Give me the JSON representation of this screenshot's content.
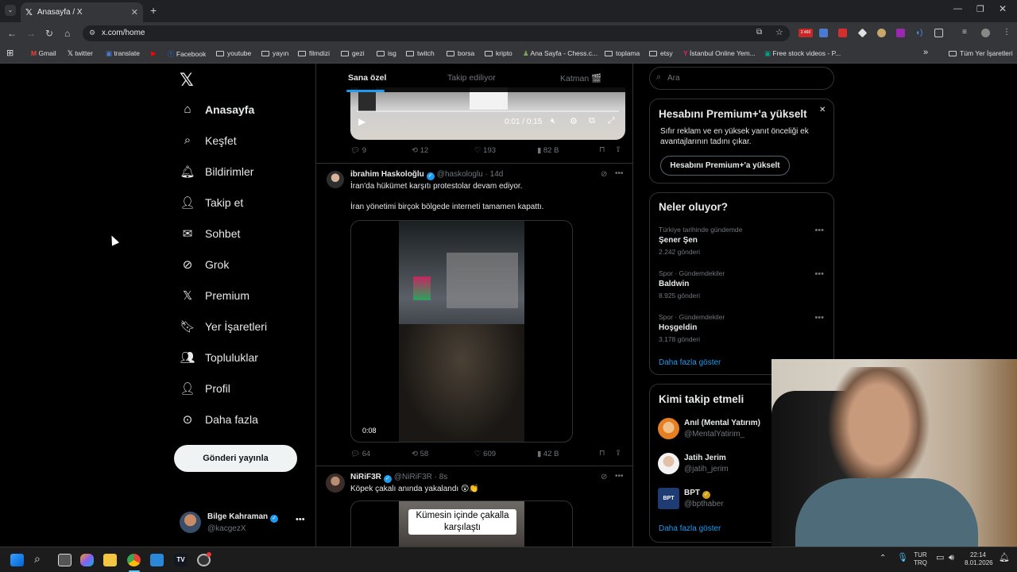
{
  "browser": {
    "tab_title": "Anasayfa / X",
    "url": "x.com/home",
    "bookmarks": [
      "Gmail",
      "twitter",
      "translate",
      "Facebook",
      "youtube",
      "yayın",
      "filmdizi",
      "gezi",
      "isg",
      "twitch",
      "borsa",
      "kripto",
      "Ana Sayfa - Chess.c...",
      "toplama",
      "etsy",
      "İstanbul Online Yem...",
      "Free stock videos - P...",
      "Tüm Yer İşaretleri"
    ],
    "ext_badge": "2.460"
  },
  "nav": {
    "items": [
      "Anasayfa",
      "Keşfet",
      "Bildirimler",
      "Takip et",
      "Sohbet",
      "Grok",
      "Premium",
      "Yer İşaretleri",
      "Topluluklar",
      "Profil",
      "Daha fazla"
    ],
    "post_button": "Gönderi yayınla",
    "profile_name": "Bilge Kahraman",
    "profile_handle": "@kacgezX"
  },
  "feed": {
    "tabs": [
      "Sana özel",
      "Takip ediliyor",
      "Katman 🎬"
    ],
    "top_video": {
      "time": "0:01 / 0:15",
      "replies": "9",
      "reposts": "12",
      "likes": "193",
      "views": "82 B"
    },
    "tweet1": {
      "name": "ibrahim Haskoloğlu",
      "handle": "@haskologlu",
      "time": "· 14d",
      "line1": "İran'da hükümet karşıtı protestolar devam ediyor.",
      "line2": "İran yönetimi birçok bölgede interneti tamamen kapattı.",
      "video_time": "0:08",
      "replies": "64",
      "reposts": "58",
      "likes": "609",
      "views": "42 B"
    },
    "tweet2": {
      "name": "NiRiF3R",
      "handle": "@NiRiF3R",
      "time": "· 8s",
      "text": "Köpek çakalı anında yakalandı 😲👏",
      "caption": "Kümesin içinde çakalla karşılaştı"
    }
  },
  "sidebar": {
    "search_placeholder": "Ara",
    "premium": {
      "title": "Hesabını Premium+'a yükselt",
      "body": "Sıfır reklam ve en yüksek yanıt önceliği ek avantajlarının tadını çıkar.",
      "button": "Hesabını Premium+'a yükselt"
    },
    "trends": {
      "title": "Neler oluyor?",
      "items": [
        {
          "meta": "Türkiye tarihinde gündemde",
          "name": "Şener Şen",
          "count": "2.242 gönderi"
        },
        {
          "meta": "Spor · Gündemdekiler",
          "name": "Baldwin",
          "count": "8.925 gönderi"
        },
        {
          "meta": "Spor · Gündemdekiler",
          "name": "Hoşgeldin",
          "count": "3.178 gönderi"
        }
      ],
      "more": "Daha fazla göster"
    },
    "who": {
      "title": "Kimi takip etmeli",
      "items": [
        {
          "name": "Anıl (Mental Yatırım)",
          "handle": "@MentalYatirim_"
        },
        {
          "name": "Jatih Jerim",
          "handle": "@jatih_jerim"
        },
        {
          "name": "BPT",
          "handle": "@bpthaber"
        }
      ],
      "more": "Daha fazla göster"
    }
  },
  "taskbar": {
    "lang": "TUR",
    "lang2": "TRQ",
    "time": "22:14",
    "date": "8.01.2026"
  },
  "colors": {
    "accent": "#1d9bf0",
    "background": "#000000",
    "border": "#2f3336"
  }
}
